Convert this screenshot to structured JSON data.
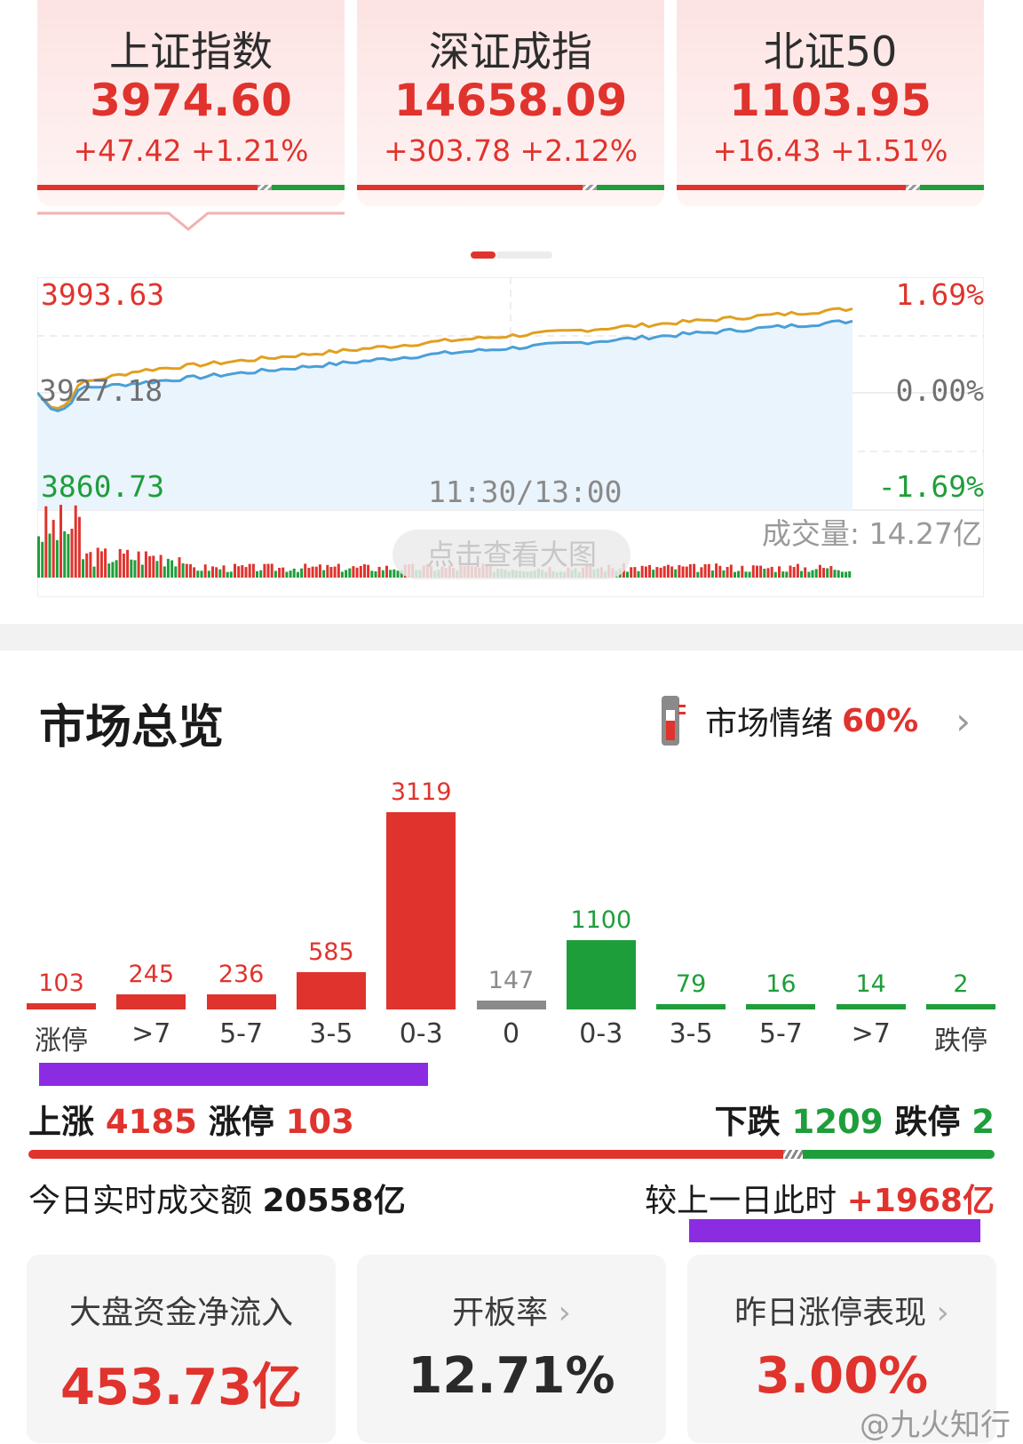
{
  "indices": [
    {
      "name": "上证指数",
      "value": "3974.60",
      "change": "+47.42  +1.21%",
      "selected": true
    },
    {
      "name": "深证成指",
      "value": "14658.09",
      "change": "+303.78  +2.12%",
      "selected": false
    },
    {
      "name": "北证50",
      "value": "1103.95",
      "change": "+16.43  +1.51%",
      "selected": false
    }
  ],
  "intraday_chart": {
    "y_high": "3993.63",
    "y_mid": "3927.18",
    "y_low": "3860.73",
    "pct_high": "1.69%",
    "pct_mid": "0.00%",
    "pct_low": "-1.69%",
    "time_label": "11:30/13:00",
    "volume": "成交量: 14.27亿",
    "view_large_label": "点击查看大图",
    "colors": {
      "index_line": "#4a9fd8",
      "avg_line": "#e0a020",
      "fill": "#eaf4fd",
      "up": "#e0332d",
      "down": "#1e9e3a"
    }
  },
  "overview": {
    "title": "市场总览",
    "mood_label": "市场情绪",
    "mood_value": "60%",
    "thermometer_icon": "thermometer-icon",
    "up_label": "上涨",
    "up_count": "4185",
    "limit_up_label": "涨停",
    "limit_up_count": "103",
    "down_label": "下跌",
    "down_count": "1209",
    "limit_down_label": "跌停",
    "limit_down_count": "2",
    "turnover_label": "今日实时成交额",
    "turnover_value": "20558亿",
    "compare_label": "较上一日此时",
    "compare_value": "+1968亿"
  },
  "chart_data": {
    "type": "bar",
    "categories": [
      "涨停",
      ">7",
      "5-7",
      "3-5",
      "0-3",
      "0",
      "0-3",
      "3-5",
      "5-7",
      ">7",
      "跌停"
    ],
    "values": [
      103,
      245,
      236,
      585,
      3119,
      147,
      1100,
      79,
      16,
      14,
      2
    ],
    "colors": [
      "#e0332d",
      "#e0332d",
      "#e0332d",
      "#e0332d",
      "#e0332d",
      "#8a8a8a",
      "#1e9e3a",
      "#1e9e3a",
      "#1e9e3a",
      "#1e9e3a",
      "#1e9e3a"
    ]
  },
  "metrics": [
    {
      "title": "大盘资金净流入",
      "value": "453.73亿",
      "has_arrow": false,
      "color": "#e0332d"
    },
    {
      "title": "开板率",
      "value": "12.71%",
      "has_arrow": true,
      "color": "#2a2a2a"
    },
    {
      "title": "昨日涨停表现",
      "value": "3.00%",
      "has_arrow": true,
      "color": "#e0332d"
    }
  ],
  "watermark": "@九火知行"
}
